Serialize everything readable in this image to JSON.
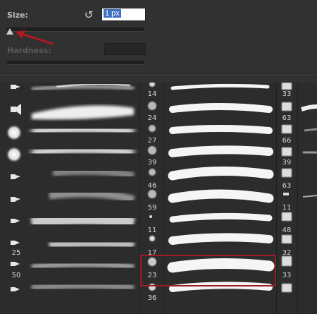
{
  "controls": {
    "size_label": "Size:",
    "size_value": "1 px",
    "hardness_label": "Hardness:"
  },
  "brushes": {
    "column1_numbers": [
      "25",
      "50"
    ],
    "column2_numbers": [
      "14",
      "24",
      "27",
      "39",
      "46",
      "59",
      "11",
      "17",
      "23",
      "36"
    ],
    "column3_numbers": [
      "33",
      "63",
      "66",
      "39",
      "63",
      "11",
      "48",
      "32",
      "33"
    ]
  },
  "colors": {
    "panel": "#313131",
    "highlight": "#a01c24",
    "arrow": "#b01822"
  }
}
